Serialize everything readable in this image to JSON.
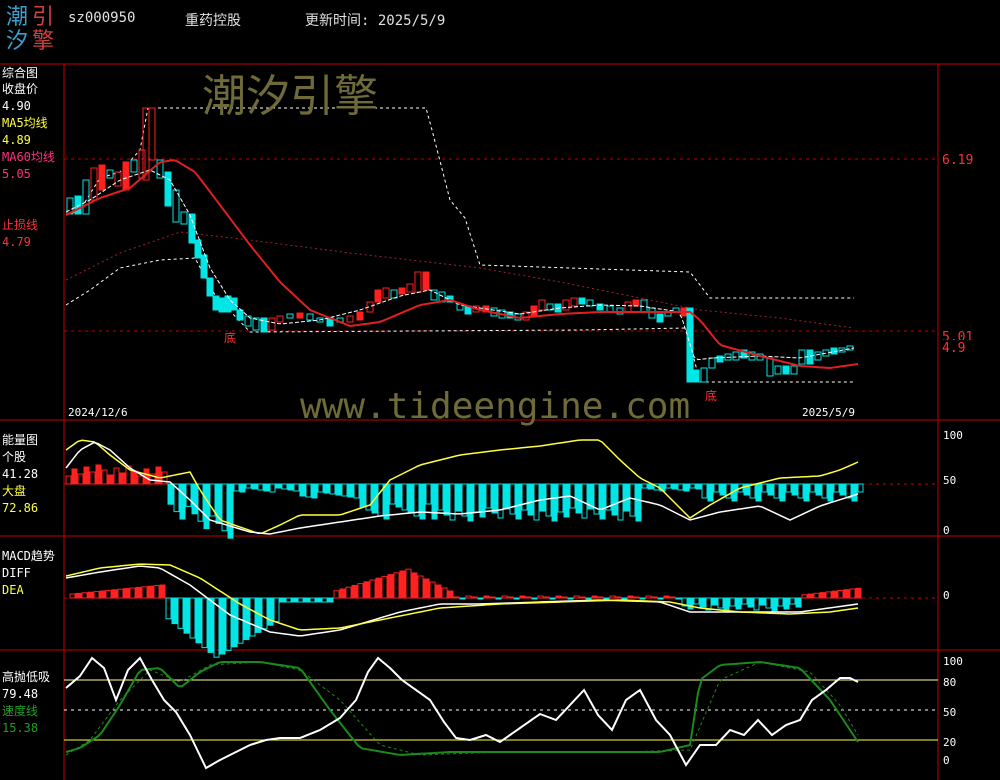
{
  "header": {
    "logo_chars": [
      "潮",
      "引",
      "汐",
      "擎"
    ],
    "code": "sz000950",
    "name": "重药控股",
    "update": "更新时间: 2025/5/9"
  },
  "watermark_cn": "潮汐引擎",
  "watermark_url": "www.tideengine.com",
  "panels": {
    "main": {
      "labels": [
        "综合图",
        "收盘价",
        "4.90",
        "MA5均线",
        "4.89",
        "MA60均线",
        "5.05",
        "止损线",
        "4.79"
      ],
      "price_ticks": [
        "6.19",
        "5.01",
        "4.9"
      ],
      "date_start": "2024/12/6",
      "date_end": "2025/5/9",
      "bottom_marks": [
        "底",
        "底"
      ]
    },
    "energy": {
      "labels": [
        "能量图",
        "个股",
        "41.28",
        "大盘",
        "72.86"
      ],
      "ticks": [
        "100",
        "50",
        "0"
      ]
    },
    "macd": {
      "labels": [
        "MACD趋势",
        "DIFF",
        "DEA"
      ],
      "ticks": [
        "0"
      ]
    },
    "tide": {
      "labels": [
        "高抛低吸",
        "79.48",
        "速度线",
        "15.38"
      ],
      "ticks": [
        "100",
        "80",
        "50",
        "20",
        "0"
      ]
    }
  },
  "colors": {
    "up": "#ff2020",
    "down": "#00e5e5",
    "axis": "#c00000",
    "ma5": "#ffffff",
    "ma60": "#e02020",
    "stop": "#ff3030",
    "yellow": "#ffff40",
    "green": "#1a8a1a"
  }
}
